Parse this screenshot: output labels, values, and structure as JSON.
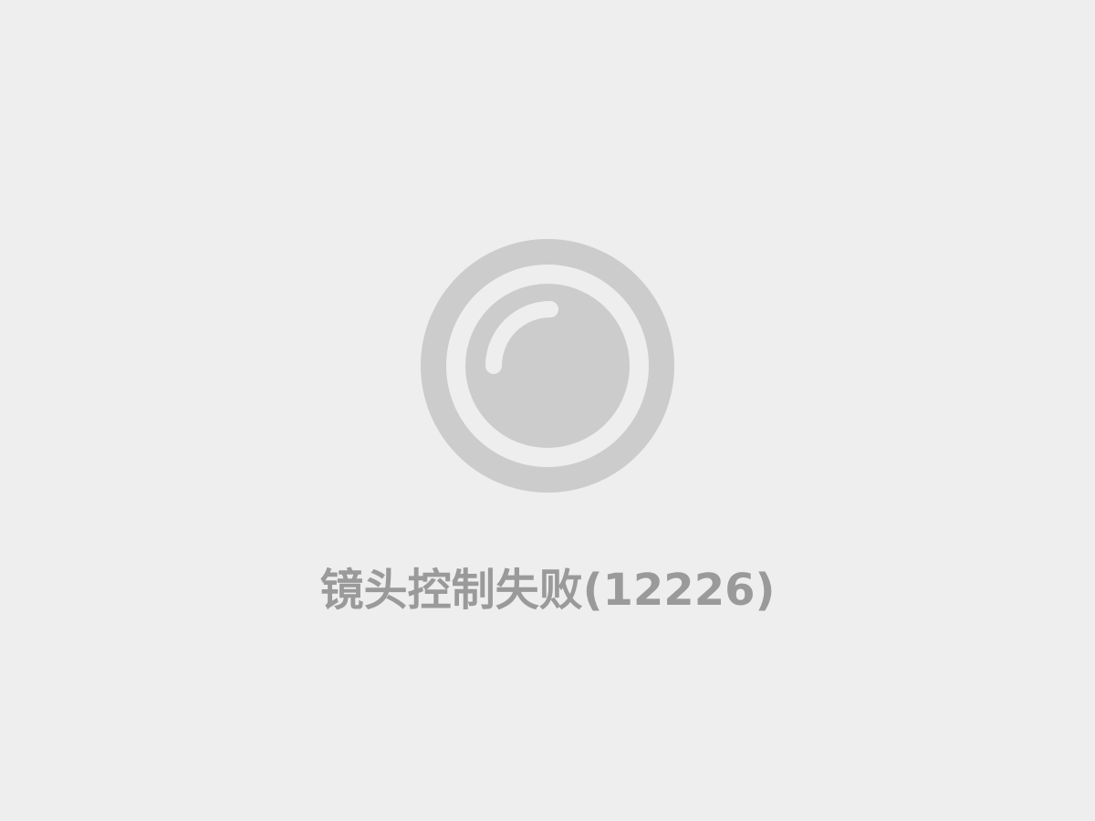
{
  "icon": {
    "name": "camera-lens-icon",
    "color": "#cccccc",
    "background": "#eeeeee"
  },
  "error": {
    "message": "镜头控制失败(12226)",
    "color": "#9a9a9a"
  }
}
